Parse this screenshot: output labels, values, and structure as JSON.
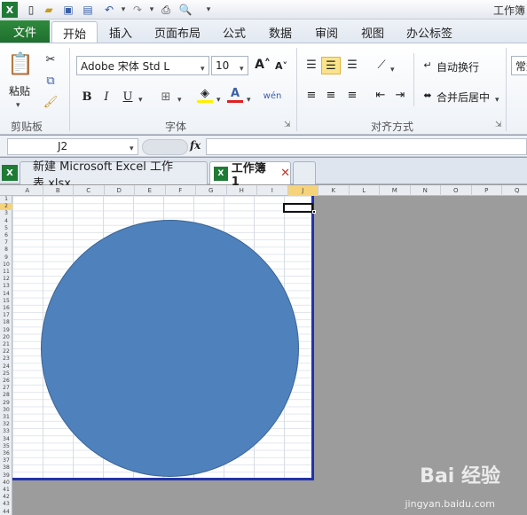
{
  "window": {
    "title": "工作簿"
  },
  "tabs": [
    {
      "label": "文件"
    },
    {
      "label": "开始"
    },
    {
      "label": "插入"
    },
    {
      "label": "页面布局"
    },
    {
      "label": "公式"
    },
    {
      "label": "数据"
    },
    {
      "label": "审阅"
    },
    {
      "label": "视图"
    },
    {
      "label": "办公标签"
    }
  ],
  "ribbon": {
    "clipboard": {
      "paste": "粘贴",
      "label": "剪贴板"
    },
    "font": {
      "name": "Adobe 宋体 Std L",
      "size": "10",
      "label": "字体",
      "bold": "B",
      "italic": "I",
      "underline": "U"
    },
    "alignment": {
      "wrap": "自动换行",
      "merge": "合并后居中",
      "label": "对齐方式"
    },
    "number": {
      "format": "常规"
    }
  },
  "formula_bar": {
    "cell_ref": "J2",
    "fx": "fx",
    "value": ""
  },
  "workbooks": [
    {
      "name": "新建 Microsoft Excel 工作表.xlsx"
    },
    {
      "name": "工作簿1"
    }
  ],
  "sheet": {
    "columns": [
      "A",
      "B",
      "C",
      "D",
      "E",
      "F",
      "G",
      "H",
      "I",
      "J",
      "K",
      "L",
      "M",
      "N",
      "O",
      "P",
      "Q"
    ],
    "rows": [
      "1",
      "2",
      "3",
      "4",
      "5",
      "6",
      "7",
      "8",
      "9",
      "10",
      "11",
      "12",
      "13",
      "14",
      "15",
      "16",
      "17",
      "18",
      "19",
      "20",
      "21",
      "22",
      "23",
      "24",
      "25",
      "26",
      "27",
      "28",
      "29",
      "30",
      "31",
      "32",
      "33",
      "34",
      "35",
      "36",
      "37",
      "38",
      "39",
      "40",
      "41",
      "42",
      "43",
      "44"
    ],
    "shape_color": "#4f81bd",
    "page_border_color": "#2233aa"
  },
  "watermark": {
    "brand": "Bai 经验",
    "url": "jingyan.baidu.com"
  }
}
